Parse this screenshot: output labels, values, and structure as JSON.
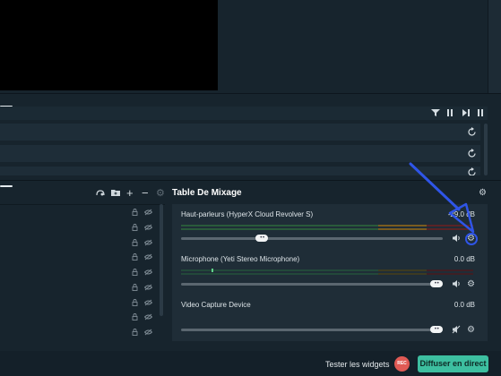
{
  "scenes": {
    "collapse_label": ""
  },
  "sources_toolbar": {
    "filter_icon": "filter-icon",
    "pause_icon": "pause-icon",
    "next_icon": "skip-next-icon",
    "more_icon": "more-icon",
    "refresh_icons": [
      "refresh-icon",
      "refresh-icon",
      "refresh-icon"
    ]
  },
  "mixer": {
    "title": "Table De Mixage",
    "settings_icon": "gear-icon",
    "tracks": [
      {
        "name": "Haut-parleurs (HyperX Cloud Revolver S)",
        "db": "-29.0 dB",
        "volume_fraction": 0.3,
        "muted": false
      },
      {
        "name": "Microphone (Yeti Stereo Microphone)",
        "db": "0.0 dB",
        "volume_fraction": 1.0,
        "muted": false
      },
      {
        "name": "Video Capture Device",
        "db": "0.0 dB",
        "volume_fraction": 1.0,
        "muted": true
      }
    ]
  },
  "scene_toolbar": {
    "icons": [
      "record-folder-icon",
      "folder-plus-icon",
      "plus-icon",
      "minus-icon",
      "gear-icon"
    ]
  },
  "footer": {
    "test_widgets": "Tester les widgets",
    "rec": "REC",
    "go_live": "Diffuser en direct"
  },
  "colors": {
    "background": "#17242d",
    "panel": "#1f2d37",
    "accent_live": "#3dbfa0",
    "rec": "#e05a55",
    "annotation_arrow": "#2f55e8"
  }
}
